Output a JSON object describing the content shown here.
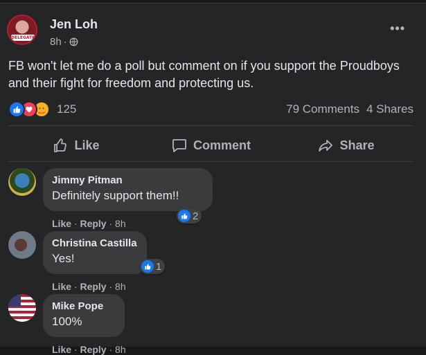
{
  "post": {
    "author": "Jen Loh",
    "time": "8h",
    "separator": "·",
    "more": "•••",
    "badge_text": "DELEGATE",
    "text": "FB won't let me do a poll but comment on if you support the Proudboys and their fight for freedom and protecting us.",
    "reaction_count": "125",
    "comments_count": "79 Comments",
    "shares_count": "4 Shares"
  },
  "actions": {
    "like": "Like",
    "comment": "Comment",
    "share": "Share"
  },
  "comments": [
    {
      "name": "Jimmy Pitman",
      "text": "Definitely support them!!",
      "reactions": "2",
      "like": "Like",
      "reply": "Reply",
      "time": "8h"
    },
    {
      "name": "Christina Castilla",
      "text": "Yes!",
      "reactions": "1",
      "like": "Like",
      "reply": "Reply",
      "time": "8h"
    },
    {
      "name": "Mike Pope",
      "text": "100%",
      "like": "Like",
      "reply": "Reply",
      "time": "8h"
    }
  ],
  "colors": {
    "bg": "#18191a",
    "card": "#242526",
    "bubble": "#3a3b3c",
    "accent": "#1877f2"
  }
}
